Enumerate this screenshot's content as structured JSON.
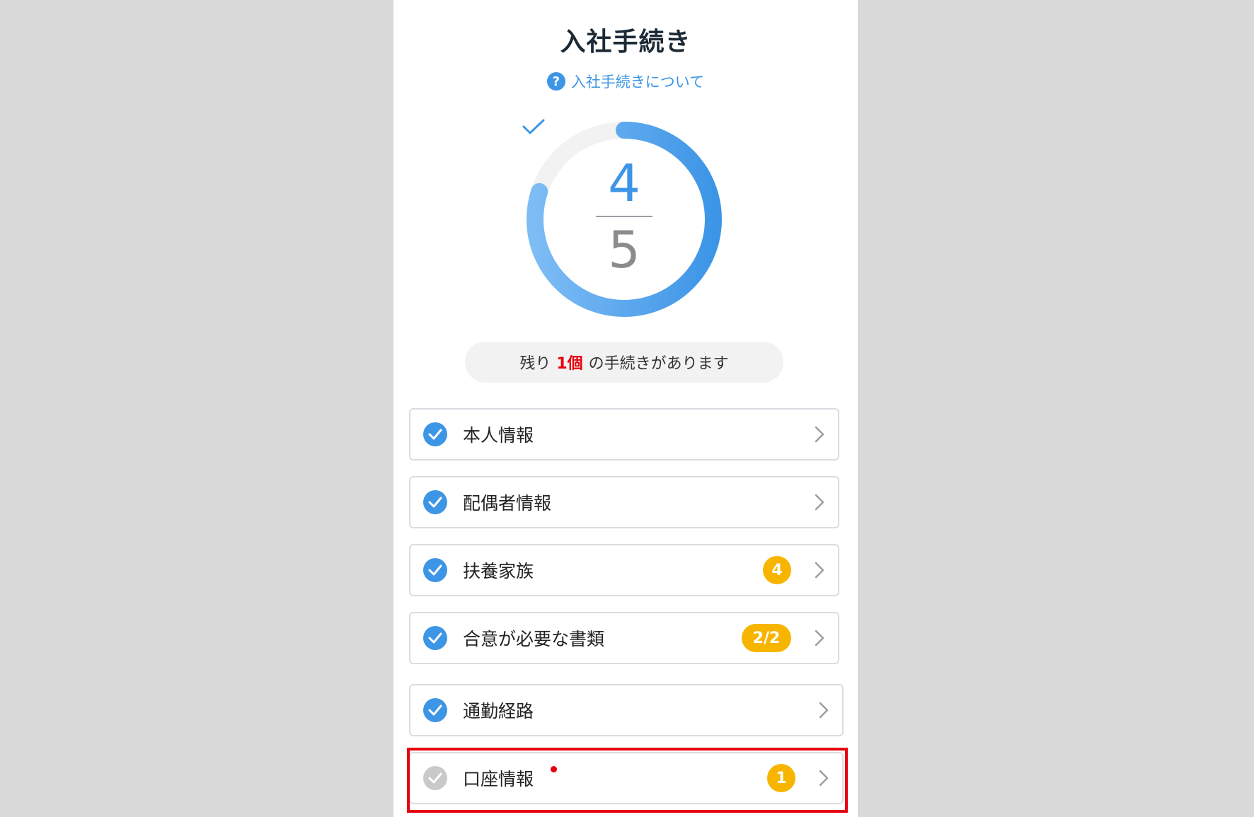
{
  "header": {
    "title": "入社手続き",
    "help_link": "入社手続きについて",
    "help_icon": "?"
  },
  "progress": {
    "completed": "4",
    "total": "5",
    "fraction": 0.8,
    "ring_color": "#3d95e6"
  },
  "remaining": {
    "prefix": "残り",
    "count": "1個",
    "suffix": "の手続きがあります"
  },
  "items": [
    {
      "label": "本人情報",
      "status": "done"
    },
    {
      "label": "配偶者情報",
      "status": "done"
    },
    {
      "label": "扶養家族",
      "status": "done",
      "badge": "4"
    },
    {
      "label": "合意が必要な書類",
      "status": "done",
      "badge": "2/2"
    },
    {
      "label": "通勤経路",
      "status": "done"
    },
    {
      "label": "口座情報",
      "status": "todo",
      "badge": "1",
      "highlighted": true
    }
  ],
  "colors": {
    "accent": "#3d95e6",
    "badge": "#f7b500",
    "alert": "#e8000d"
  }
}
